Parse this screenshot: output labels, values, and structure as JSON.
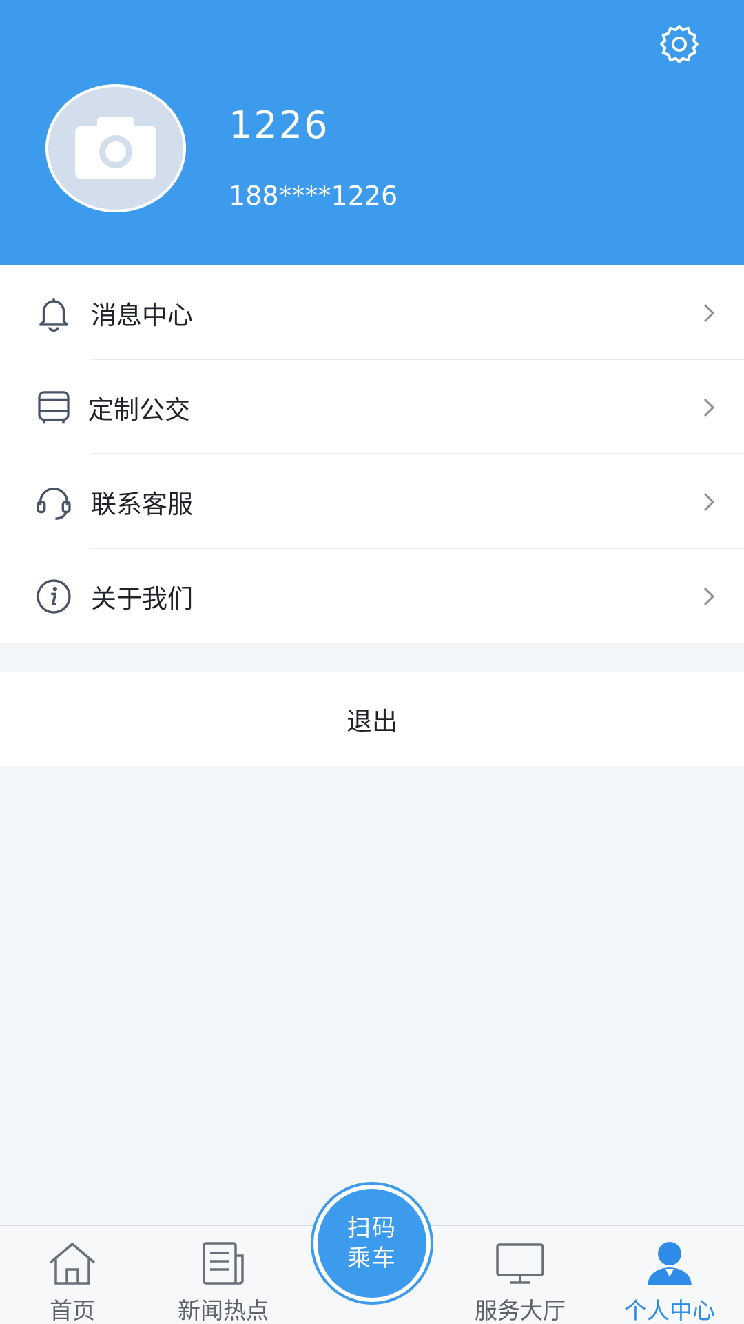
{
  "profile": {
    "username": "1226",
    "phone": "188****1226",
    "avatar_icon": "camera-icon",
    "settings_icon": "gear-icon"
  },
  "menu": {
    "items": [
      {
        "label": "消息中心",
        "icon": "bell-icon"
      },
      {
        "label": "定制公交",
        "icon": "bus-icon"
      },
      {
        "label": "联系客服",
        "icon": "headset-icon"
      },
      {
        "label": "关于我们",
        "icon": "info-icon"
      }
    ]
  },
  "logout": {
    "label": "退出"
  },
  "bottom_nav": {
    "items": [
      {
        "label": "首页",
        "icon": "home-icon"
      },
      {
        "label": "新闻热点",
        "icon": "news-icon"
      },
      {
        "label": "服务大厅",
        "icon": "monitor-icon"
      },
      {
        "label": "个人中心",
        "icon": "user-icon",
        "active": true
      }
    ],
    "scan": {
      "line1": "扫码",
      "line2": "乘车"
    }
  },
  "colors": {
    "primary": "#3d9bee",
    "active_tab": "#2f8ce8",
    "background": "#f3f6f8"
  }
}
